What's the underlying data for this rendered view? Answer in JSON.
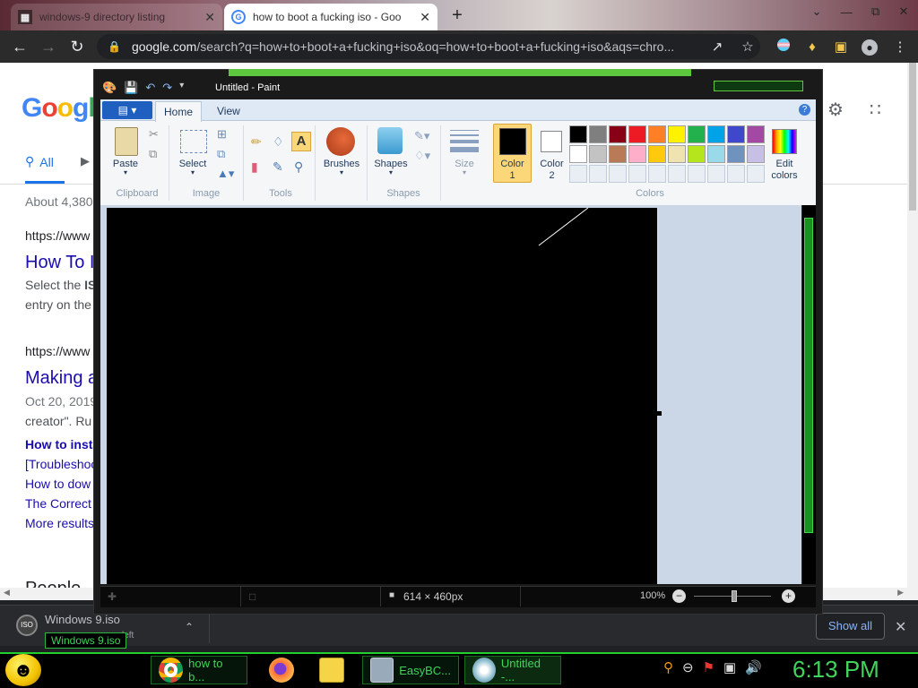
{
  "browser": {
    "tabs": [
      {
        "title": "windows-9 directory listing",
        "active": false
      },
      {
        "title": "how to boot a fucking iso - Goo",
        "active": true
      }
    ],
    "omnibox": {
      "host": "google.com",
      "path": "/search?q=how+to+boot+a+fucking+iso&oq=how+to+boot+a+fucking+iso&aqs=chro..."
    }
  },
  "google": {
    "logo": "Google",
    "tab_all": "All",
    "stats": "About 4,380",
    "results": [
      {
        "url": "https://www",
        "title": "How To I",
        "snippet_prefix": "Select the ",
        "snippet_bold": "IS",
        "snippet2": "entry on the"
      },
      {
        "url": "https://www",
        "title": "Making a",
        "date": "Oct 20, 2019",
        "snippet2": "creator\". Ru"
      }
    ],
    "related": {
      "bold": "How to insta",
      "links": [
        "[Troubleshoo",
        "How to dow",
        "The Correct",
        "More results"
      ]
    },
    "people": "People"
  },
  "downloads": {
    "name": "Windows 9.iso",
    "sub": "left",
    "tooltip": "Windows 9.iso",
    "show_all": "Show all"
  },
  "paint": {
    "title": "Untitled - Paint",
    "tabs": {
      "file": "▤ ▾",
      "home": "Home",
      "view": "View"
    },
    "groups": {
      "clipboard": "Clipboard",
      "image": "Image",
      "tools": "Tools",
      "shapes": "Shapes",
      "colors": "Colors"
    },
    "buttons": {
      "paste": "Paste",
      "select": "Select",
      "brushes": "Brushes",
      "shapes": "Shapes",
      "size": "Size",
      "color1_a": "Color",
      "color1_b": "1",
      "color2_a": "Color",
      "color2_b": "2",
      "edit_a": "Edit",
      "edit_b": "colors"
    },
    "palette_row1": [
      "#000000",
      "#7f7f7f",
      "#880015",
      "#ed1c24",
      "#ff7f27",
      "#fff200",
      "#22b14c",
      "#00a2e8",
      "#3f48cc",
      "#a349a4"
    ],
    "palette_row2": [
      "#ffffff",
      "#c3c3c3",
      "#b97a57",
      "#ffaec9",
      "#ffc90e",
      "#efe4b0",
      "#b5e61d",
      "#99d9ea",
      "#7092be",
      "#c8bfe7"
    ],
    "color1": "#000000",
    "color2": "#ffffff",
    "status_size": "614 × 460px",
    "zoom": "100%"
  },
  "taskbar": {
    "items": [
      {
        "label": "how to b..."
      },
      {
        "label": ""
      },
      {
        "label": ""
      },
      {
        "label": "EasyBC..."
      },
      {
        "label": "Untitled -..."
      }
    ],
    "clock": "6:13 PM"
  }
}
